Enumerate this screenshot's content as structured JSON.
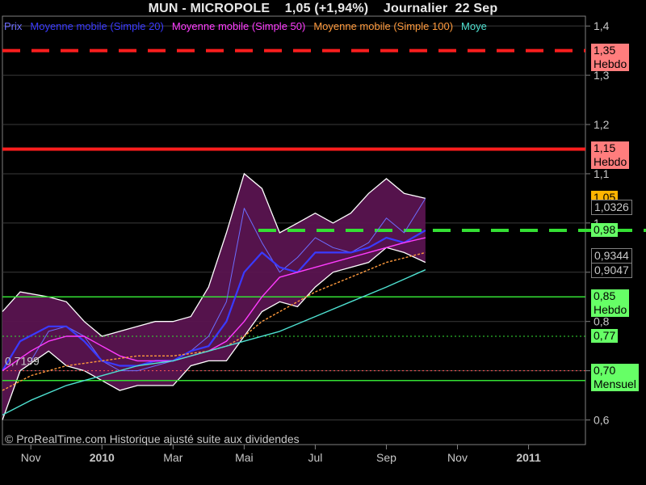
{
  "header": {
    "title": "MUN - MICROPOLE    1,05 (+1,94%)    Journalier  22 Sep"
  },
  "legend": [
    {
      "label": "Prix",
      "color": "#6d6dff"
    },
    {
      "label": "Moyenne mobile (Simple 20)",
      "color": "#3a3aff"
    },
    {
      "label": "Moyenne mobile (Simple 50)",
      "color": "#ff3cff"
    },
    {
      "label": "Moyenne mobile (Simple 100)",
      "color": "#ff9a3c"
    },
    {
      "label": "Moye",
      "color": "#4ee0d0"
    }
  ],
  "footer": {
    "text": "© ProRealTime.com Historique ajusté suite aux dividendes"
  },
  "chart_data": {
    "type": "line",
    "title": "MUN - MICROPOLE    1,05 (+1,94%)    Journalier  22 Sep",
    "ylim": [
      0.55,
      1.42
    ],
    "y_ticks": [
      "1,4",
      "1,3",
      "1,2",
      "1,1",
      "1",
      "0,9",
      "0,8",
      "0,7",
      "0,6"
    ],
    "y_tick_values": [
      1.4,
      1.3,
      1.2,
      1.1,
      1.0,
      0.9,
      0.8,
      0.7,
      0.6
    ],
    "x_ticks": [
      "Nov",
      "2010",
      "Mar",
      "Mai",
      "Jul",
      "Sep",
      "Nov",
      "2011"
    ],
    "x_tick_months": [
      0,
      2,
      4,
      6,
      8,
      10,
      12,
      14
    ],
    "x_month_range": [
      -0.8,
      15.6
    ],
    "x_origin": "Oct 2009",
    "grid": true,
    "series": [
      {
        "name": "Prix",
        "color": "#6d6dff",
        "x": [
          0,
          0.5,
          1,
          1.5,
          2,
          2.5,
          3,
          3.5,
          4,
          4.5,
          5,
          5.5,
          6,
          6.5,
          7,
          7.5,
          8,
          8.5,
          9,
          9.5,
          10,
          10.5,
          11.1
        ],
        "y": [
          0.72,
          0.78,
          0.79,
          0.77,
          0.72,
          0.7,
          0.7,
          0.71,
          0.72,
          0.74,
          0.77,
          0.84,
          1.03,
          0.96,
          0.9,
          0.93,
          0.97,
          0.95,
          0.94,
          0.96,
          1.01,
          0.98,
          1.05
        ]
      },
      {
        "name": "Moyenne mobile (Simple 20)",
        "color": "#3a3aff",
        "x": [
          -0.8,
          -0.3,
          0.5,
          1,
          1.5,
          2,
          2.5,
          3,
          3.5,
          4,
          4.5,
          5,
          5.5,
          6,
          6.5,
          7,
          7.5,
          8,
          8.5,
          9,
          9.5,
          10,
          10.5,
          11.1
        ],
        "y": [
          0.7,
          0.76,
          0.79,
          0.79,
          0.76,
          0.72,
          0.71,
          0.71,
          0.72,
          0.72,
          0.74,
          0.75,
          0.8,
          0.9,
          0.94,
          0.91,
          0.9,
          0.94,
          0.94,
          0.94,
          0.95,
          0.97,
          0.96,
          0.985
        ]
      },
      {
        "name": "Moyenne mobile (Simple 50)",
        "color": "#ff3cff",
        "x": [
          -0.8,
          0,
          0.5,
          1,
          1.5,
          2,
          2.5,
          3,
          3.5,
          4,
          4.5,
          5,
          5.5,
          6,
          6.5,
          7,
          7.5,
          8,
          8.5,
          9,
          9.5,
          10,
          10.5,
          11.1
        ],
        "y": [
          0.7,
          0.74,
          0.76,
          0.77,
          0.77,
          0.75,
          0.73,
          0.72,
          0.72,
          0.72,
          0.73,
          0.74,
          0.76,
          0.8,
          0.85,
          0.89,
          0.9,
          0.91,
          0.92,
          0.93,
          0.94,
          0.95,
          0.96,
          0.97
        ]
      },
      {
        "name": "Moyenne mobile (Simple 100)",
        "color": "#ff9a3c",
        "x": [
          -0.8,
          0,
          1,
          2,
          3,
          4,
          5,
          5.5,
          6,
          6.5,
          7,
          7.5,
          8,
          9,
          10,
          11.1
        ],
        "y": [
          0.66,
          0.69,
          0.71,
          0.72,
          0.73,
          0.73,
          0.74,
          0.75,
          0.77,
          0.8,
          0.82,
          0.84,
          0.86,
          0.89,
          0.92,
          0.94
        ]
      },
      {
        "name": "Moye",
        "color": "#4ee0d0",
        "x": [
          -0.8,
          0,
          1,
          2,
          3,
          4,
          5,
          6,
          7,
          8,
          9,
          10,
          11.1
        ],
        "y": [
          0.61,
          0.64,
          0.67,
          0.69,
          0.71,
          0.72,
          0.74,
          0.76,
          0.78,
          0.81,
          0.84,
          0.87,
          0.905
        ]
      }
    ],
    "bands": {
      "upper_x": [
        -0.8,
        -0.3,
        0.5,
        1,
        1.5,
        2,
        2.5,
        3,
        3.5,
        4,
        4.5,
        5,
        5.5,
        6,
        6.5,
        7,
        7.5,
        8,
        8.5,
        9,
        9.5,
        10,
        10.5,
        11.1
      ],
      "upper_y": [
        0.82,
        0.86,
        0.85,
        0.84,
        0.8,
        0.77,
        0.78,
        0.79,
        0.8,
        0.8,
        0.81,
        0.87,
        0.98,
        1.1,
        1.07,
        0.98,
        1.0,
        1.02,
        1.0,
        1.02,
        1.06,
        1.09,
        1.06,
        1.05
      ],
      "lower_y": [
        0.6,
        0.7,
        0.74,
        0.71,
        0.7,
        0.68,
        0.66,
        0.67,
        0.67,
        0.67,
        0.71,
        0.72,
        0.72,
        0.77,
        0.82,
        0.84,
        0.83,
        0.87,
        0.9,
        0.91,
        0.92,
        0.95,
        0.94,
        0.92
      ]
    },
    "annotations": [
      {
        "label": "0,7199",
        "y": 0.7199
      }
    ]
  },
  "levels": [
    {
      "value": 1.35,
      "label": "1,35",
      "sub": "Hebdo",
      "style": "dashed",
      "color": "#ff1e1e",
      "bg": "#ff7d7d",
      "fg": "#000000"
    },
    {
      "value": 1.15,
      "label": "1,15",
      "sub": "Hebdo",
      "style": "solid",
      "color": "#ff1e1e",
      "bg": "#ff7d7d",
      "fg": "#000000"
    },
    {
      "value": 0.985,
      "label": "0,98",
      "sub": "",
      "style": "dashed",
      "color": "#34e034",
      "bg": "#66ff66",
      "fg": "#000000"
    },
    {
      "value": 0.85,
      "label": "0,85",
      "sub": "Hebdo",
      "style": "solid",
      "color": "#34e034",
      "bg": "#66ff66",
      "fg": "#000000"
    },
    {
      "value": 0.77,
      "label": "0,77",
      "sub": "",
      "style": "dotted",
      "color": "#34e034",
      "bg": "#66ff66",
      "fg": "#000000"
    },
    {
      "value": 0.7,
      "label": "0,70",
      "sub": "Mensuel",
      "style": "dotted",
      "color": "#ff5555",
      "bg": "#66ff66",
      "fg": "#000000"
    },
    {
      "value": 0.68,
      "label": "",
      "sub": "",
      "style": "solid",
      "color": "#34e034",
      "bg": "",
      "fg": ""
    }
  ],
  "price_tags": [
    {
      "value": 1.05,
      "label": "1,05",
      "bg": "#ffb400",
      "fg": "#000000"
    },
    {
      "value": 1.0326,
      "label": "1,0326",
      "bg": "#000000",
      "fg": "#c8c8c8"
    },
    {
      "value": 0.9344,
      "label": "0,9344",
      "bg": "#000000",
      "fg": "#c8c8c8"
    },
    {
      "value": 0.9047,
      "label": "0,9047",
      "bg": "#000000",
      "fg": "#c8c8c8"
    }
  ]
}
